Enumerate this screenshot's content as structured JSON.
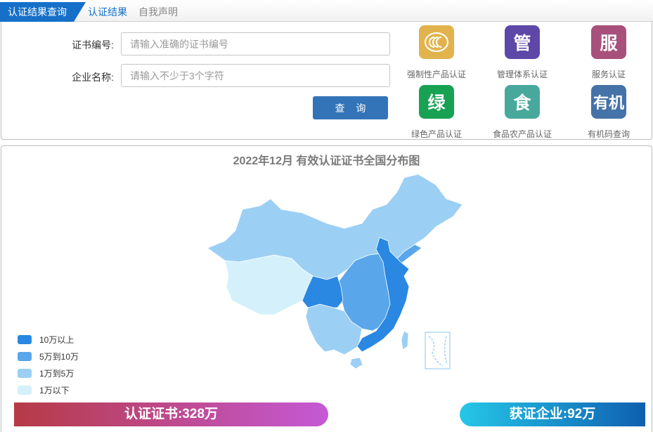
{
  "tabs": {
    "active": "认证结果查询",
    "items": [
      "认证结果",
      "自我声明"
    ]
  },
  "query": {
    "cert_label": "证书编号:",
    "cert_placeholder": "请输入准确的证书编号",
    "company_label": "企业名称:",
    "company_placeholder": "请输入不少于3个字符",
    "submit": "查 询"
  },
  "categories": [
    {
      "glyph": "",
      "label": "强制性产品认证",
      "color": "#e2b34d",
      "icon": "ccc-icon"
    },
    {
      "glyph": "管",
      "label": "管理体系认证",
      "color": "#5d48a8",
      "icon": "management-icon"
    },
    {
      "glyph": "服",
      "label": "服务认证",
      "color": "#a8507c",
      "icon": "service-icon"
    },
    {
      "glyph": "绿",
      "label": "绿色产品认证",
      "color": "#17a152",
      "icon": "green-icon"
    },
    {
      "glyph": "食",
      "label": "食品农产品认证",
      "color": "#48a89c",
      "icon": "food-icon"
    },
    {
      "glyph": "有机",
      "label": "有机码查询",
      "color": "#4573a7",
      "icon": "organic-icon"
    }
  ],
  "map": {
    "title": "2022年12月  有效认证证书全国分布图",
    "legend": [
      {
        "label": "10万以上",
        "color": "#2a88e2"
      },
      {
        "label": "5万到10万",
        "color": "#5aa6ea"
      },
      {
        "label": "1万到5万",
        "color": "#9ccff4"
      },
      {
        "label": "1万以下",
        "color": "#d4f1fb"
      }
    ]
  },
  "stats": {
    "certificates": "认证证书:328万",
    "companies": "获证企业:92万"
  }
}
